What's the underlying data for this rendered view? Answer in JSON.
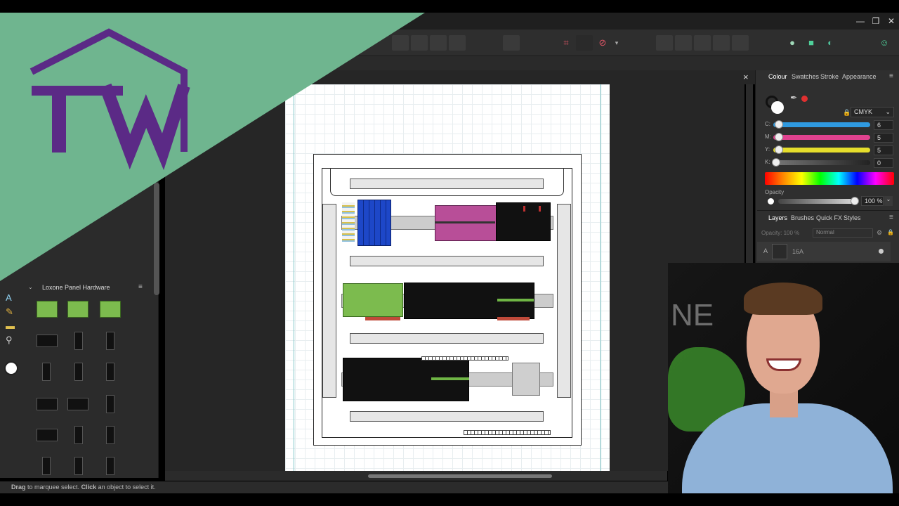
{
  "window": {
    "minimize_icon": "minimize-icon",
    "restore_icon": "restore-icon",
    "close_icon": "close-icon"
  },
  "logo": {
    "text": "TW",
    "bg_color": "#6fb58f",
    "mark_color": "#5b2a86"
  },
  "document": {
    "close_glyph": "×"
  },
  "assets": {
    "panel_title": "Loxone Panel Hardware",
    "menu_glyph": "≡"
  },
  "studio": {
    "tabs_top": [
      "Colour",
      "Swatches",
      "Stroke",
      "Appearance"
    ],
    "color_model": "CMYK",
    "sliders": [
      {
        "label": "C:",
        "value": "6",
        "color": "#2f9ae0"
      },
      {
        "label": "M:",
        "value": "5",
        "color": "#e0428f"
      },
      {
        "label": "Y:",
        "value": "5",
        "color": "#e6de2c"
      },
      {
        "label": "K:",
        "value": "0",
        "color": "#444444"
      }
    ],
    "opacity_label": "Opacity",
    "opacity_value": "100 %",
    "tabs_bottom": [
      "Layers",
      "Brushes",
      "Quick FX",
      "Styles"
    ],
    "layer_opacity": "Opacity: 100 %",
    "blend_mode": "Normal",
    "layer_name": "16A",
    "layer_prefix": "A"
  },
  "status": {
    "drag_bold": "Drag",
    "drag_text": " to marquee select. ",
    "click_bold": "Click",
    "click_text": " an object to select it."
  },
  "webcam": {
    "bg_text": "NE"
  }
}
